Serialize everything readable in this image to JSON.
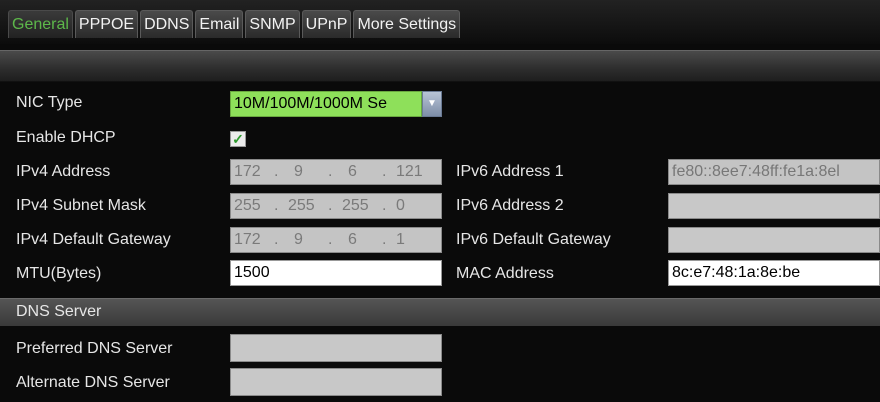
{
  "tabs": [
    {
      "label": "General",
      "active": true
    },
    {
      "label": "PPPOE",
      "active": false
    },
    {
      "label": "DDNS",
      "active": false
    },
    {
      "label": "Email",
      "active": false
    },
    {
      "label": "SNMP",
      "active": false
    },
    {
      "label": "UPnP",
      "active": false
    },
    {
      "label": "More Settings",
      "active": false
    }
  ],
  "form": {
    "nic_type_label": "NIC Type",
    "nic_type_value": "10M/100M/1000M Se",
    "enable_dhcp_label": "Enable DHCP",
    "enable_dhcp_checked": true,
    "check_glyph": "✓",
    "dropdown_glyph": "▼",
    "ipv4_address_label": "IPv4 Address",
    "ipv4_address": [
      "172",
      "9",
      "6",
      "121"
    ],
    "ipv4_subnet_label": "IPv4 Subnet Mask",
    "ipv4_subnet": [
      "255",
      "255",
      "255",
      "0"
    ],
    "ipv4_gateway_label": "IPv4 Default Gateway",
    "ipv4_gateway": [
      "172",
      "9",
      "6",
      "1"
    ],
    "dot": ".",
    "mtu_label": "MTU(Bytes)",
    "mtu_value": "1500",
    "ipv6_address1_label": "IPv6 Address 1",
    "ipv6_address1_value": "fe80::8ee7:48ff:fe1a:8el",
    "ipv6_address2_label": "IPv6 Address 2",
    "ipv6_address2_value": "",
    "ipv6_gateway_label": "IPv6 Default Gateway",
    "ipv6_gateway_value": "",
    "mac_label": "MAC Address",
    "mac_value": "8c:e7:48:1a:8e:be"
  },
  "dns": {
    "section_title": "DNS Server",
    "preferred_label": "Preferred DNS Server",
    "preferred_value": "",
    "alternate_label": "Alternate DNS Server",
    "alternate_value": ""
  },
  "colors": {
    "active_tab": "#5db84a",
    "nic_highlight": "#8ee05a",
    "checkmark": "#2e9a2e"
  }
}
